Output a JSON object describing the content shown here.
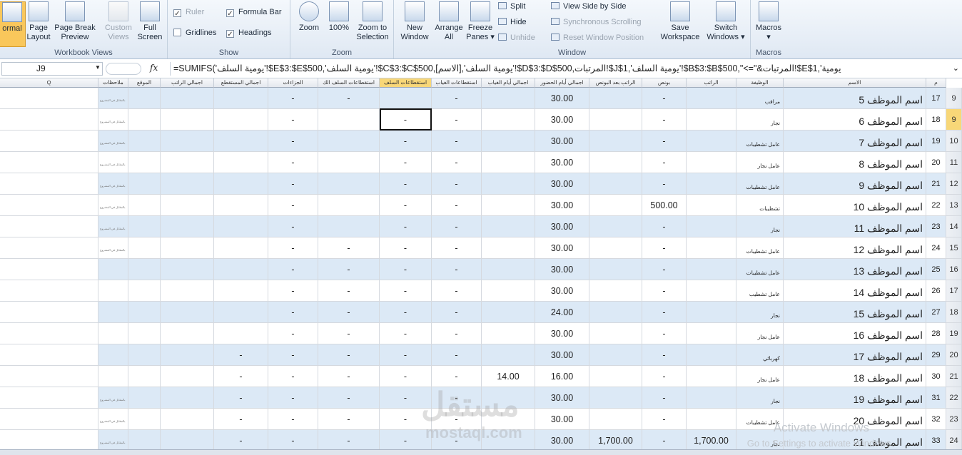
{
  "ribbon": {
    "workbook_views": {
      "label": "Workbook Views",
      "normal": "ormal",
      "page_layout": [
        "Page",
        "Layout"
      ],
      "page_break": [
        "Page Break",
        "Preview"
      ],
      "custom_views": [
        "Custom",
        "Views"
      ],
      "full_screen": [
        "Full",
        "Screen"
      ]
    },
    "show": {
      "label": "Show",
      "ruler": "Ruler",
      "formula_bar": "Formula Bar",
      "gridlines": "Gridlines",
      "headings": "Headings"
    },
    "zoom": {
      "label": "Zoom",
      "zoom": "Zoom",
      "hundred": "100%",
      "zoom_selection": [
        "Zoom to",
        "Selection"
      ]
    },
    "window": {
      "label": "Window",
      "new_window": [
        "New",
        "Window"
      ],
      "arrange_all": [
        "Arrange",
        "All"
      ],
      "freeze_panes": [
        "Freeze",
        "Panes ▾"
      ],
      "split": "Split",
      "hide": "Hide",
      "unhide": "Unhide",
      "view_side": "View Side by Side",
      "sync_scroll": "Synchronous Scrolling",
      "reset_pos": "Reset Window Position",
      "save_ws": [
        "Save",
        "Workspace"
      ],
      "switch_win": [
        "Switch",
        "Windows ▾"
      ]
    },
    "macros": {
      "label": "Macros",
      "macros": [
        "Macros",
        "▾"
      ]
    }
  },
  "formula_bar": {
    "name_box": "J9",
    "fx": "fx",
    "formula": "=SUMIFS('يومية السلف'!$E$3:$E$500,'يومية السلف'!$C$3:$C$500,[الاسم],'يومية السلف'!$D$3:$D$500,المرتبات!$J$1,'يومية السلف'!$B$3:$B$500,\"<=\"&المرتبات!$E$1,'يومية"
  },
  "columns": {
    "q": "Q",
    "notes": "ملاحظات",
    "location": "الموقع",
    "net_salary": "اجمالي الراتب",
    "total_deducted": "اجمالي المستقطع",
    "penalties": "الجزاءات",
    "adv_deduct_k": "استقطاعات السلف الك",
    "adv_deduct": "استقطاعات السلف",
    "absence_deduct": "استقطاعات الغياب",
    "absence_days": "اجمالي أيام الغياب",
    "attendance_days": "اجمالي أيام الحضور",
    "salary_after_bonus": "الراتب بعد البونص",
    "bonus": "بونص",
    "salary": "الراتب",
    "job": "الوظيفة",
    "name": "الاسم",
    "idx": "م"
  },
  "note_text": "بالمقابل في المشروع",
  "rows": [
    {
      "r": "9",
      "i": "17",
      "name": "اسم الموظف 5",
      "job": "مراقب",
      "bonus": "-",
      "att": "30.00",
      "abs": "",
      "absd": "-",
      "adv": "",
      "advk": "-",
      "pen": "-",
      "tot": "",
      "net": "",
      "note": true
    },
    {
      "r": "9",
      "i": "18",
      "name": "اسم الموظف 6",
      "job": "نجار",
      "bonus": "-",
      "att": "30.00",
      "abs": "",
      "absd": "-",
      "adv": "-",
      "advk": "",
      "pen": "-",
      "tot": "",
      "net": "",
      "note": true,
      "sel": true
    },
    {
      "r": "10",
      "i": "19",
      "name": "اسم الموظف 7",
      "job": "عامل تشطيبات",
      "bonus": "-",
      "att": "30.00",
      "abs": "",
      "absd": "-",
      "adv": "-",
      "advk": "",
      "pen": "-",
      "tot": "",
      "net": "",
      "note": true
    },
    {
      "r": "11",
      "i": "20",
      "name": "اسم الموظف 8",
      "job": "عامل نجار",
      "bonus": "-",
      "att": "30.00",
      "abs": "",
      "absd": "-",
      "adv": "-",
      "advk": "",
      "pen": "-",
      "tot": "",
      "net": "",
      "note": true
    },
    {
      "r": "12",
      "i": "21",
      "name": "اسم الموظف 9",
      "job": "عامل تشطيبات",
      "bonus": "-",
      "att": "30.00",
      "abs": "",
      "absd": "-",
      "adv": "-",
      "advk": "",
      "pen": "-",
      "tot": "",
      "net": "",
      "note": true
    },
    {
      "r": "13",
      "i": "22",
      "name": "اسم الموظف 10",
      "job": "تشطيبات",
      "bonus": "500.00",
      "att": "30.00",
      "abs": "",
      "absd": "-",
      "adv": "-",
      "advk": "",
      "pen": "-",
      "tot": "",
      "net": "",
      "note": true
    },
    {
      "r": "14",
      "i": "23",
      "name": "اسم الموظف 11",
      "job": "نجار",
      "bonus": "-",
      "att": "30.00",
      "abs": "",
      "absd": "-",
      "adv": "-",
      "advk": "",
      "pen": "-",
      "tot": "",
      "net": "",
      "note": true
    },
    {
      "r": "15",
      "i": "24",
      "name": "اسم الموظف 12",
      "job": "عامل تشطيبات",
      "bonus": "-",
      "att": "30.00",
      "abs": "",
      "absd": "-",
      "adv": "-",
      "advk": "-",
      "pen": "-",
      "tot": "",
      "net": "",
      "note": true
    },
    {
      "r": "16",
      "i": "25",
      "name": "اسم الموظف 13",
      "job": "عامل تشطيبات",
      "bonus": "-",
      "att": "30.00",
      "abs": "",
      "absd": "-",
      "adv": "-",
      "advk": "-",
      "pen": "-",
      "tot": "",
      "net": "",
      "note": false
    },
    {
      "r": "17",
      "i": "26",
      "name": "اسم الموظف 14",
      "job": "عامل تشطيب",
      "bonus": "-",
      "att": "30.00",
      "abs": "",
      "absd": "-",
      "adv": "-",
      "advk": "-",
      "pen": "-",
      "tot": "",
      "net": "",
      "note": false
    },
    {
      "r": "18",
      "i": "27",
      "name": "اسم الموظف 15",
      "job": "نجار",
      "bonus": "-",
      "att": "24.00",
      "abs": "",
      "absd": "-",
      "adv": "-",
      "advk": "-",
      "pen": "-",
      "tot": "",
      "net": "",
      "note": false
    },
    {
      "r": "19",
      "i": "28",
      "name": "اسم الموظف 16",
      "job": "عامل نجار",
      "bonus": "-",
      "att": "30.00",
      "abs": "",
      "absd": "-",
      "adv": "-",
      "advk": "-",
      "pen": "-",
      "tot": "",
      "net": "",
      "note": false
    },
    {
      "r": "20",
      "i": "29",
      "name": "اسم الموظف 17",
      "job": "كهربائي",
      "bonus": "-",
      "att": "30.00",
      "abs": "",
      "absd": "-",
      "adv": "-",
      "advk": "-",
      "pen": "-",
      "tot": "-",
      "net": "",
      "note": false
    },
    {
      "r": "21",
      "i": "30",
      "name": "اسم الموظف 18",
      "job": "عامل نجار",
      "bonus": "-",
      "att": "16.00",
      "abs": "14.00",
      "absd": "-",
      "adv": "-",
      "advk": "-",
      "pen": "-",
      "tot": "-",
      "net": "",
      "note": false
    },
    {
      "r": "22",
      "i": "31",
      "name": "اسم الموظف 19",
      "job": "نجار",
      "bonus": "-",
      "att": "30.00",
      "abs": "",
      "absd": "-",
      "adv": "-",
      "advk": "-",
      "pen": "-",
      "tot": "-",
      "net": "",
      "note": true
    },
    {
      "r": "23",
      "i": "32",
      "name": "اسم الموظف 20",
      "job": "عامل تشطيبات",
      "bonus": "-",
      "att": "30.00",
      "abs": "",
      "absd": "-",
      "adv": "-",
      "advk": "-",
      "pen": "-",
      "tot": "-",
      "net": "",
      "note": true
    },
    {
      "r": "24",
      "i": "33",
      "name": "اسم الموظف 21",
      "job": "نجار",
      "bonus": "-",
      "att": "30.00",
      "abs": "",
      "absd": "-",
      "adv": "-",
      "advk": "-",
      "pen": "-",
      "tot": "-",
      "net": "",
      "note": true,
      "salary": "1,700.00",
      "sab": "1,700.00"
    }
  ],
  "overlay": {
    "activate": "Activate Windows",
    "activate_sub": "Go to Settings to activate Windows.",
    "watermark": "مستقل",
    "watermark_sub": "mostaql.com"
  },
  "colors": {
    "band": "#dce9f6",
    "selected": "#f8d778"
  }
}
